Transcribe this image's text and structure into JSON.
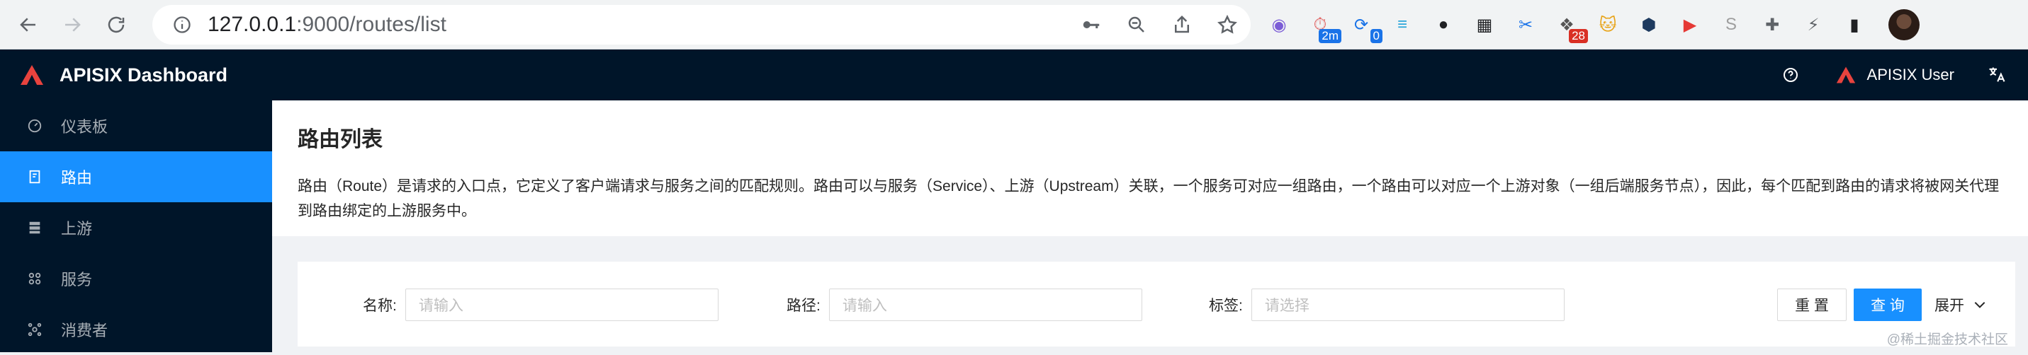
{
  "browser": {
    "url_host": "127.0.0.1",
    "url_rest": ":9000/routes/list",
    "extensions": [
      {
        "name": "chrome-ext-1-icon",
        "glyph": "◉",
        "color": "#7b5cd6"
      },
      {
        "name": "timer-ext-icon",
        "glyph": "⏱",
        "color": "#e05d5d",
        "badge": "2m",
        "badge_color": "#1a73e8"
      },
      {
        "name": "sync-ext-icon",
        "glyph": "⟳",
        "color": "#1a73e8",
        "badge": "0",
        "badge_color": "#1a73e8"
      },
      {
        "name": "filter-ext-icon",
        "glyph": "≡",
        "color": "#2aa5d9"
      },
      {
        "name": "github-ext-icon",
        "glyph": "●",
        "color": "#202124"
      },
      {
        "name": "qr-ext-icon",
        "glyph": "▦",
        "color": "#202124"
      },
      {
        "name": "scissors-ext-icon",
        "glyph": "✂",
        "color": "#1a73e8"
      },
      {
        "name": "grid-ext-icon",
        "glyph": "❖",
        "color": "#555",
        "badge": "28",
        "badge_color": "#d93025"
      },
      {
        "name": "cat-ext-icon",
        "glyph": "🐱",
        "color": "#e8a317"
      },
      {
        "name": "hex-ext-icon",
        "glyph": "⬢",
        "color": "#1e3a5f"
      },
      {
        "name": "play-ext-icon",
        "glyph": "▶",
        "color": "#e53935"
      },
      {
        "name": "s-ext-icon",
        "glyph": "S",
        "color": "#9e9e9e"
      },
      {
        "name": "puzzle-ext-icon",
        "glyph": "✚",
        "color": "#5f6368"
      },
      {
        "name": "lightning-ext-icon",
        "glyph": "⚡",
        "color": "#5f6368"
      },
      {
        "name": "sidepanel-ext-icon",
        "glyph": "▮",
        "color": "#202124"
      }
    ]
  },
  "header": {
    "app_title": "APISIX Dashboard",
    "user_name": "APISIX User",
    "lang_glyph": "文A"
  },
  "sidebar": {
    "items": [
      {
        "label": "仪表板",
        "name": "sidebar-item-dashboard",
        "icon": "dashboard-icon",
        "active": false
      },
      {
        "label": "路由",
        "name": "sidebar-item-routes",
        "icon": "route-icon",
        "active": true
      },
      {
        "label": "上游",
        "name": "sidebar-item-upstream",
        "icon": "database-icon",
        "active": false
      },
      {
        "label": "服务",
        "name": "sidebar-item-service",
        "icon": "apps-icon",
        "active": false
      },
      {
        "label": "消费者",
        "name": "sidebar-item-consumer",
        "icon": "cluster-icon",
        "active": false
      }
    ]
  },
  "page": {
    "title": "路由列表",
    "description": "路由（Route）是请求的入口点，它定义了客户端请求与服务之间的匹配规则。路由可以与服务（Service）、上游（Upstream）关联，一个服务可对应一组路由，一个路由可以对应一个上游对象（一组后端服务节点），因此，每个匹配到路由的请求将被网关代理到路由绑定的上游服务中。"
  },
  "filter": {
    "name_label": "名称:",
    "name_placeholder": "请输入",
    "path_label": "路径:",
    "path_placeholder": "请输入",
    "tags_label": "标签:",
    "tags_placeholder": "请选择",
    "reset_label": "重 置",
    "query_label": "查 询",
    "expand_label": "展开"
  },
  "watermark": "@稀土掘金技术社区",
  "colors": {
    "primary": "#1890ff",
    "header_bg": "#001529",
    "brand_red": "#e8433e"
  }
}
